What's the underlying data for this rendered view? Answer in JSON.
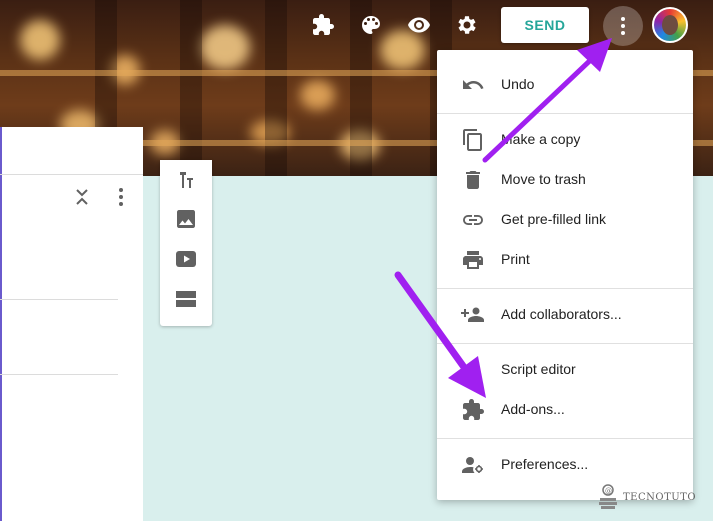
{
  "toolbar": {
    "send_label": "SEND",
    "icons": [
      "puzzle-icon",
      "palette-icon",
      "eye-icon",
      "gear-icon",
      "more-vert-icon"
    ]
  },
  "menu": {
    "items": [
      {
        "label": "Undo",
        "icon": "undo-icon"
      },
      {
        "label": "Make a copy",
        "icon": "copy-icon"
      },
      {
        "label": "Move to trash",
        "icon": "trash-icon"
      },
      {
        "label": "Get pre-filled link",
        "icon": "link-icon"
      },
      {
        "label": "Print",
        "icon": "print-icon"
      },
      {
        "label": "Add collaborators...",
        "icon": "add-people-icon"
      },
      {
        "label": "Script editor",
        "icon": ""
      },
      {
        "label": "Add-ons...",
        "icon": "puzzle-icon"
      },
      {
        "label": "Preferences...",
        "icon": "person-settings-icon"
      }
    ]
  },
  "watermark": {
    "text": "TECNOTUTO"
  },
  "colors": {
    "accent": "#26a69a",
    "arrow": "#a020f0",
    "canvas": "#d9efed",
    "icon_gray": "#616161"
  }
}
